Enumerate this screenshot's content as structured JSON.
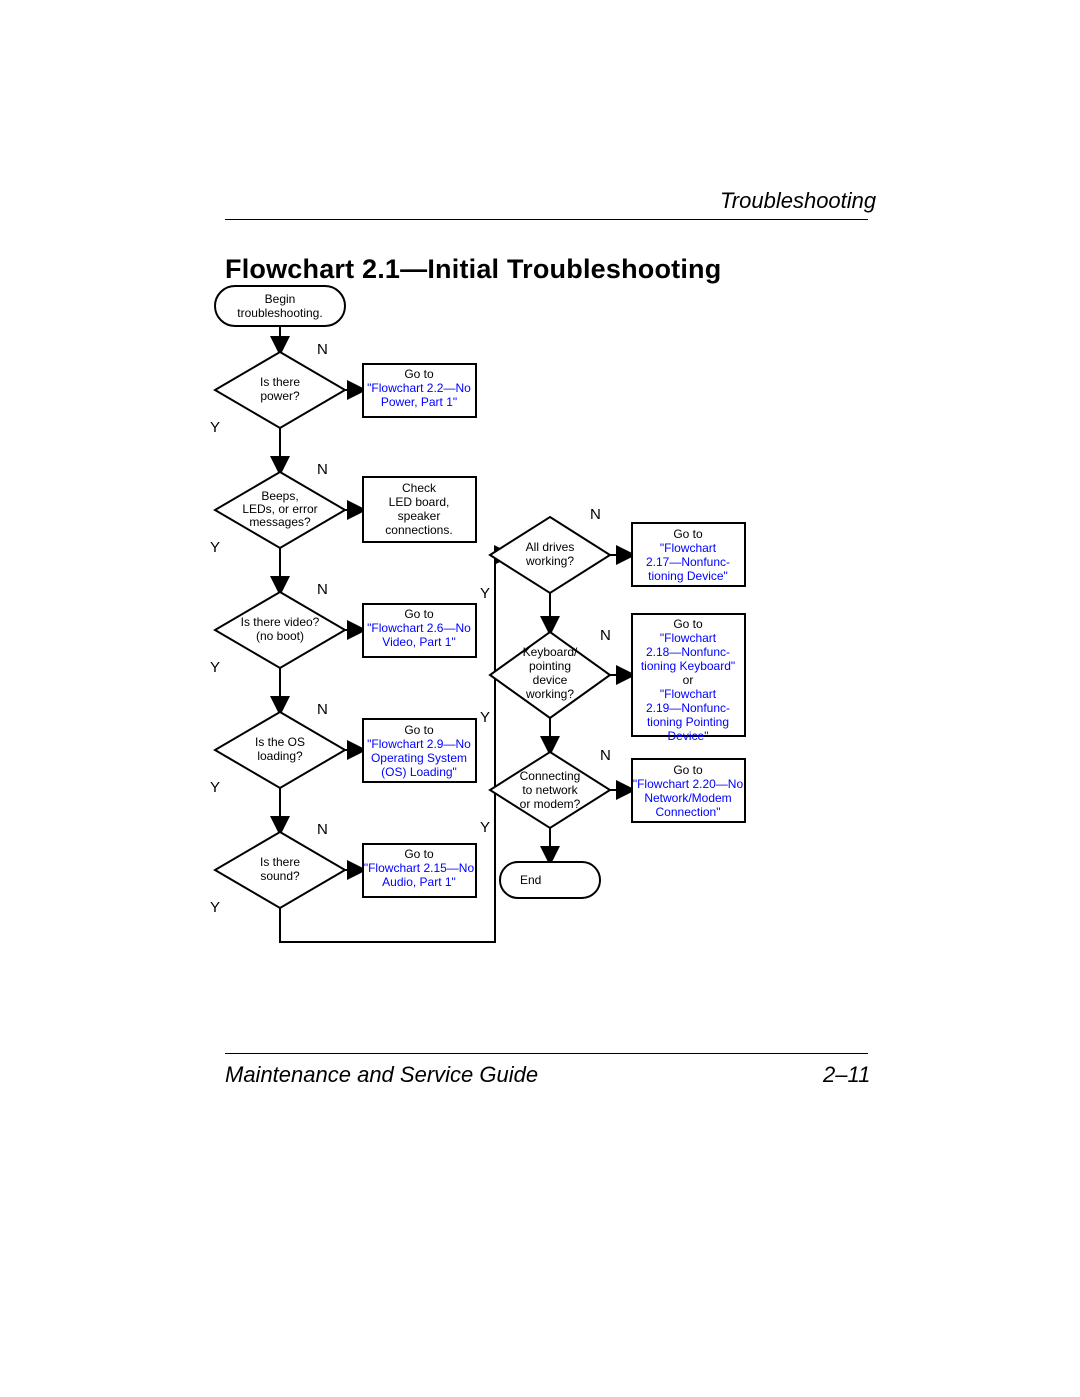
{
  "header": {
    "section": "Troubleshooting"
  },
  "title": "Flowchart 2.1—Initial Troubleshooting",
  "footer": {
    "left": "Maintenance and Service Guide",
    "right": "2–11"
  },
  "labels": {
    "y": "Y",
    "n": "N",
    "or": "or"
  },
  "nodes": {
    "begin": {
      "l1": "Begin",
      "l2": "troubleshooting."
    },
    "d_power": {
      "l1": "Is there",
      "l2": "power?"
    },
    "d_beeps": {
      "l1": "Beeps,",
      "l2": "LEDs, or error",
      "l3": "messages?"
    },
    "d_video": {
      "l1": "Is there video?",
      "l2": "(no boot)"
    },
    "d_os": {
      "l1": "Is the OS",
      "l2": "loading?"
    },
    "d_sound": {
      "l1": "Is there",
      "l2": "sound?"
    },
    "d_drives": {
      "l1": "All drives",
      "l2": "working?"
    },
    "d_kbd": {
      "l1": "Keyboard/",
      "l2": "pointing",
      "l3": "device",
      "l4": "working?"
    },
    "d_net": {
      "l1": "Connecting",
      "l2": "to network",
      "l3": "or modem?"
    },
    "end": "End",
    "goto": "Go to",
    "p_power": "\"Flowchart 2.2—No Power, Part 1\"",
    "p_led": {
      "l1": "Check",
      "l2": "LED board,",
      "l3": "speaker",
      "l4": "connections."
    },
    "p_video": "\"Flowchart 2.6—No Video, Part 1\"",
    "p_os": "\"Flowchart 2.9—No Operating System (OS) Loading\"",
    "p_audio": "\"Flowchart 2.15—No Audio, Part 1\"",
    "p_drives": "\"Flowchart 2.17—Nonfunc-tioning Device\"",
    "p_kbd_a": "\"Flowchart 2.18—Nonfunc-tioning Keyboard\"",
    "p_kbd_b": "\"Flowchart 2.19—Nonfunc-tioning Pointing Device\"",
    "p_net": "\"Flowchart 2.20—No Network/Modem Connection\""
  }
}
